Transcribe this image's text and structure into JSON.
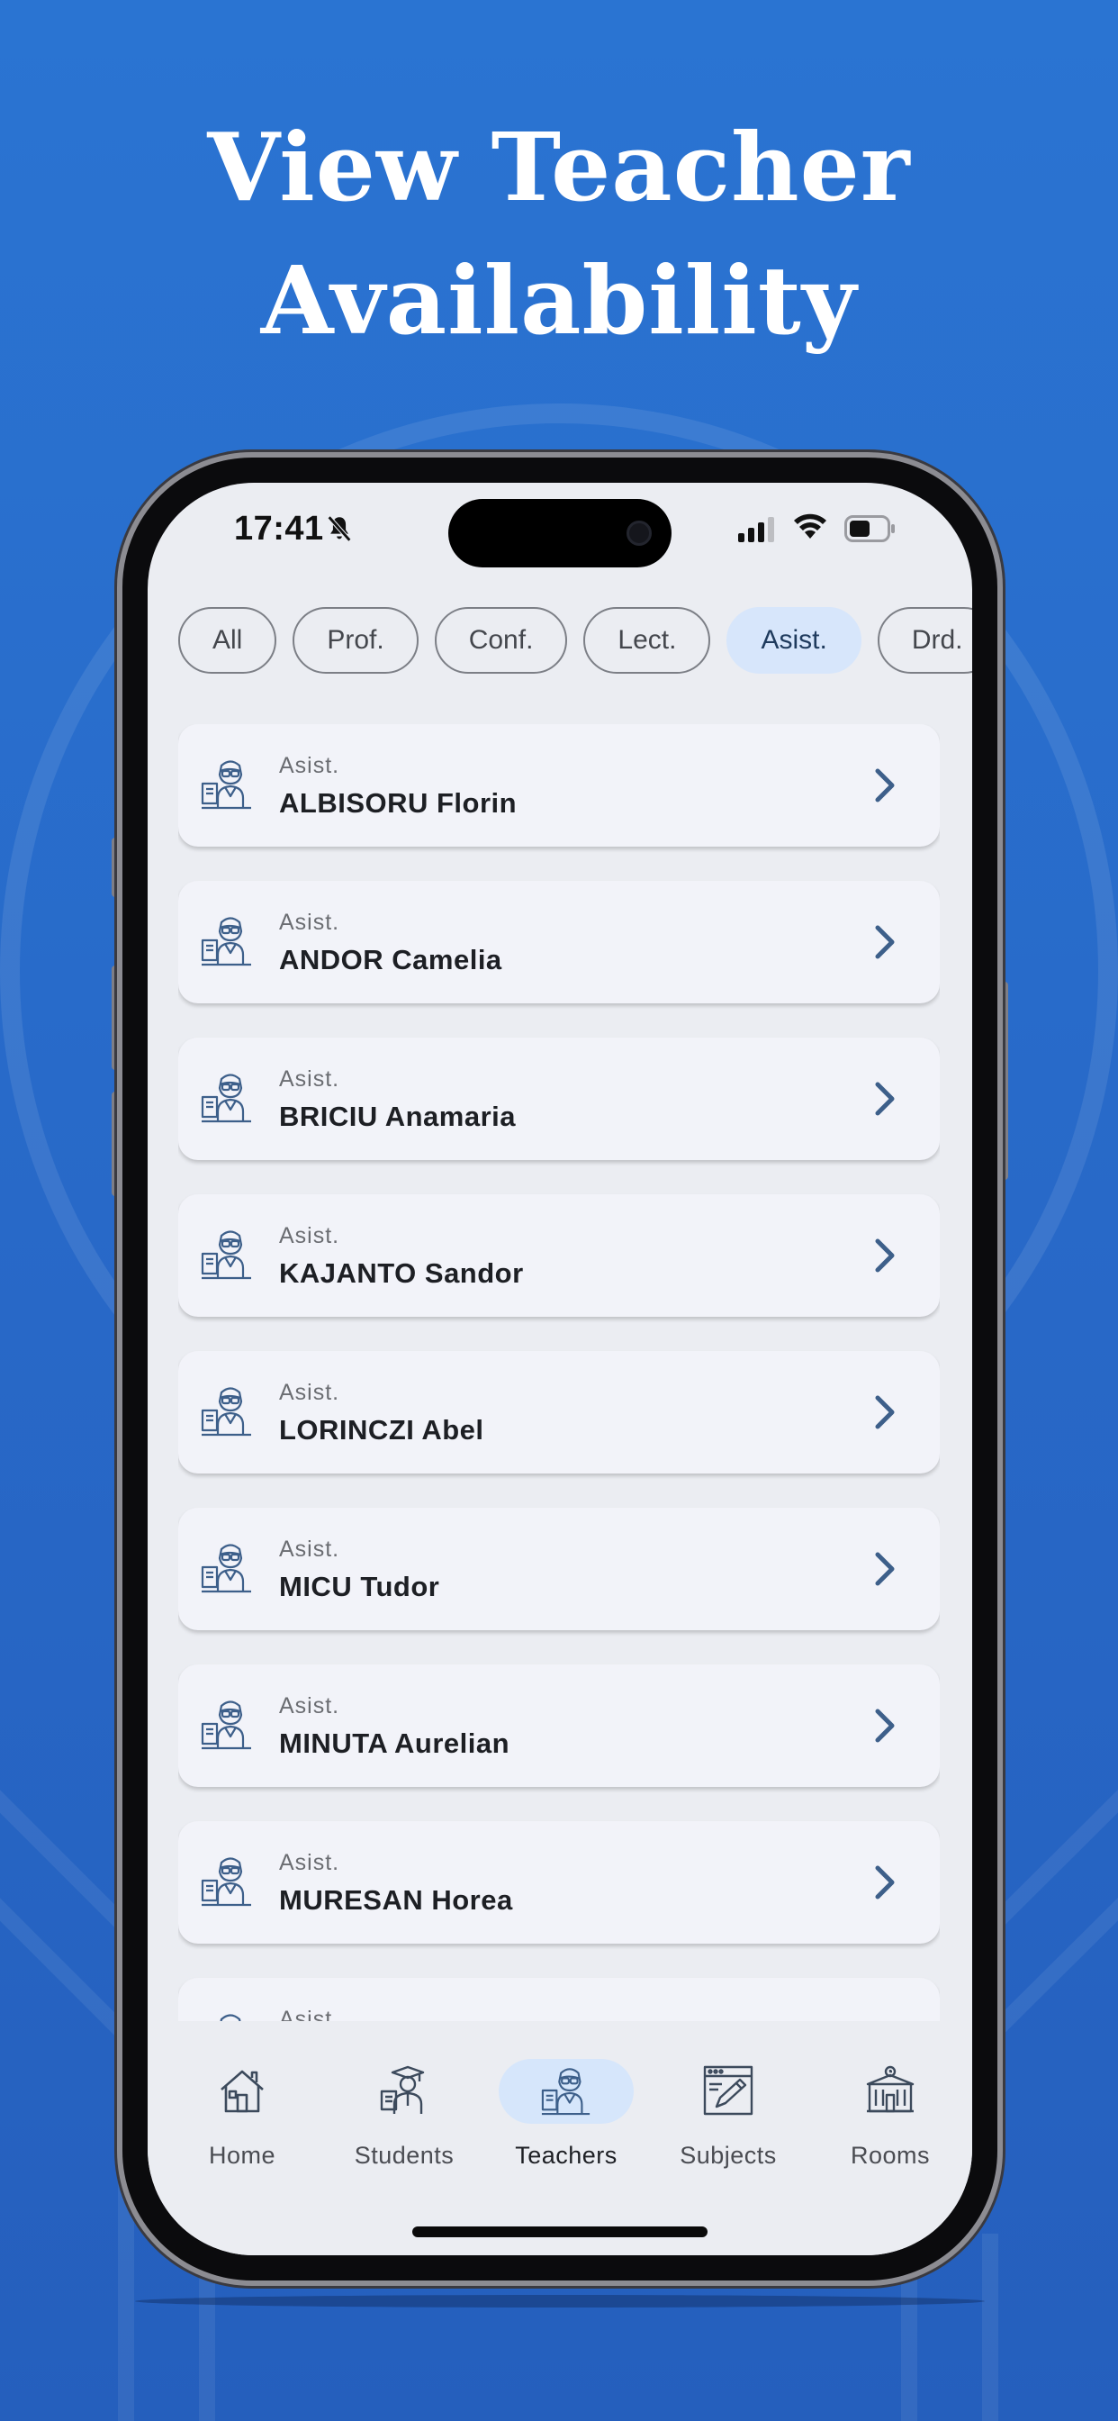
{
  "headline": {
    "line1": "View Teacher",
    "line2": "Availability"
  },
  "status": {
    "time": "17:41"
  },
  "filters": [
    {
      "label": "All",
      "active": false
    },
    {
      "label": "Prof.",
      "active": false
    },
    {
      "label": "Conf.",
      "active": false
    },
    {
      "label": "Lect.",
      "active": false
    },
    {
      "label": "Asist.",
      "active": true
    },
    {
      "label": "Drd.",
      "active": false
    }
  ],
  "teachers": [
    {
      "title": "Asist.",
      "name": "ALBISORU Florin"
    },
    {
      "title": "Asist.",
      "name": "ANDOR Camelia"
    },
    {
      "title": "Asist.",
      "name": "BRICIU Anamaria"
    },
    {
      "title": "Asist.",
      "name": "KAJANTO Sandor"
    },
    {
      "title": "Asist.",
      "name": "LORINCZI Abel"
    },
    {
      "title": "Asist.",
      "name": "MICU Tudor"
    },
    {
      "title": "Asist.",
      "name": "MINUTA Aurelian"
    },
    {
      "title": "Asist.",
      "name": "MURESAN Horea"
    },
    {
      "title": "Asist.",
      "name": ""
    }
  ],
  "nav": {
    "items": [
      {
        "label": "Home",
        "icon": "home-icon",
        "active": false
      },
      {
        "label": "Students",
        "icon": "student-icon",
        "active": false
      },
      {
        "label": "Teachers",
        "icon": "teacher-icon",
        "active": true
      },
      {
        "label": "Subjects",
        "icon": "subjects-icon",
        "active": false
      },
      {
        "label": "Rooms",
        "icon": "rooms-icon",
        "active": false
      }
    ]
  },
  "colors": {
    "accent": "#3d5f8a",
    "active_pill": "#d6e6fb",
    "background": "#2a74d2"
  }
}
